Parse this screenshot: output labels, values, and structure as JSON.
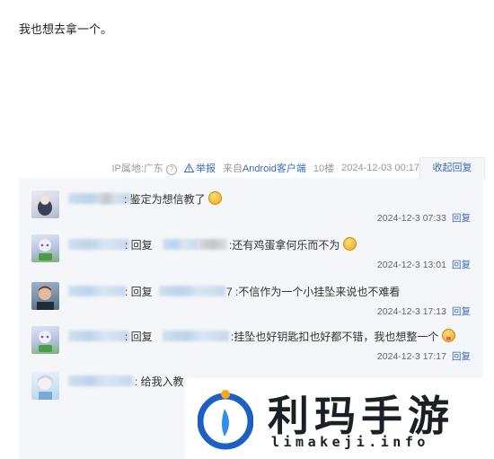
{
  "post": {
    "text": "我也想去拿一个。"
  },
  "meta": {
    "ip_label": "IP属地:广东",
    "help_icon": "question-circle-icon",
    "report_label": "举报",
    "source_prefix": "来自",
    "source_link": "Android客户端",
    "floor": "10楼",
    "datetime": "2024-12-03 00:17",
    "collapse_label": "收起回复"
  },
  "replies": [
    {
      "text": ": 鉴定为想信教了",
      "emoji": "grin",
      "time": "2024-12-3 07:33",
      "reply_label": "回复"
    },
    {
      "prefix": ": 回复",
      "text": ":还有鸡蛋拿何乐而不为",
      "emoji": "smile",
      "time": "2024-12-3 13:01",
      "reply_label": "回复"
    },
    {
      "prefix": ": 回复",
      "mid_suffix": "7",
      "text": ":不信作为一个小挂坠来说也不难看",
      "time": "2024-12-3 17:13",
      "reply_label": "回复"
    },
    {
      "prefix": ": 回复",
      "text": ":挂坠也好钥匙扣也好都不错，我也想整一个",
      "emoji": "tongue",
      "time": "2024-12-3 17:17",
      "reply_label": "回复"
    },
    {
      "text": ": 给我入教"
    }
  ],
  "watermark": {
    "title": "利玛手游",
    "url": "limakeji.info"
  },
  "colors": {
    "link": "#3a6bbf",
    "reply_bg": "#f4f6f9"
  }
}
